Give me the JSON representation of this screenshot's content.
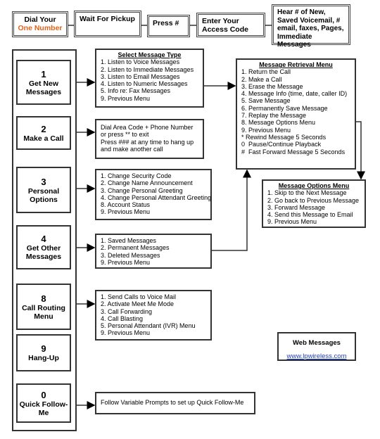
{
  "steps": [
    {
      "line1": "Dial Your",
      "line2": "One Number"
    },
    {
      "label": "Wait For Pickup"
    },
    {
      "label": "Press #"
    },
    {
      "label": "Enter Your Access Code"
    },
    {
      "label": "Hear # of New, Saved Voicemail, # email, faxes, Pages, Immediate Messages"
    }
  ],
  "keys": [
    {
      "num": "1",
      "label": "Get New Messages"
    },
    {
      "num": "2",
      "label": "Make a Call"
    },
    {
      "num": "3",
      "label": "Personal Options"
    },
    {
      "num": "4",
      "label": "Get Other Messages"
    },
    {
      "num": "8",
      "label": "Call Routing Menu"
    },
    {
      "num": "9",
      "label": "Hang-Up"
    },
    {
      "num": "0",
      "label": "Quick Follow-Me"
    }
  ],
  "select": {
    "title": "Select Message Type",
    "items": [
      "1. Listen to Voice Messages",
      "2. Listen to Immediate Messages",
      "3. Listen to Email Messages",
      "4. Listen to Numeric Messages",
      "5. Info re: Fax Messages",
      "9. Previous Menu"
    ]
  },
  "call": {
    "items": [
      "Dial Area Code + Phone Number",
      "or press ** to exit",
      "Press ### at any time to hang up",
      "and make another call"
    ]
  },
  "personal": {
    "items": [
      "1. Change Security Code",
      "2. Change Name Announcement",
      "3. Change Personal Greeting",
      "4. Change Personal Attendant Greeting",
      "8. Account Status",
      "9. Previous Menu"
    ]
  },
  "other": {
    "items": [
      "1. Saved Messages",
      "2. Permanent Messages",
      "3. Deleted Messages",
      "9. Previous Menu"
    ]
  },
  "routing": {
    "items": [
      "1. Send Calls to Voice Mail",
      "2. Activate Meet Me Mode",
      "3. Call Forwarding",
      "4. Call Blasting",
      "5. Personal Attendant (IVR) Menu",
      "9. Previous Menu"
    ]
  },
  "follow": {
    "text": "Follow Variable Prompts to set up Quick Follow-Me"
  },
  "retrieval": {
    "title": "Message Retrieval Menu",
    "items": [
      "1. Return the Call",
      "2. Make a Call",
      "3. Erase the Message",
      "4. Message Info (time, date, caller ID)",
      "5. Save Message",
      "6. Permanently Save Message",
      "7. Replay the Message",
      "8. Message Options Menu",
      "9. Previous Menu",
      "* Rewind Message 5 Seconds",
      "0  Pause/Continue Playback",
      "#  Fast Forward Message 5 Seconds"
    ]
  },
  "options": {
    "title": "Message Options Menu",
    "items": [
      "1. Skip to the Next Message",
      "2. Go back to Previous Message",
      "3. Forward Message",
      "4. Send this Message to Email",
      "9. Previous Menu"
    ]
  },
  "web": {
    "title": "Web Messages",
    "link": "www.lpwireless.com"
  },
  "colors": {
    "accent": "#e0621b",
    "link": "#1a3fc0"
  }
}
